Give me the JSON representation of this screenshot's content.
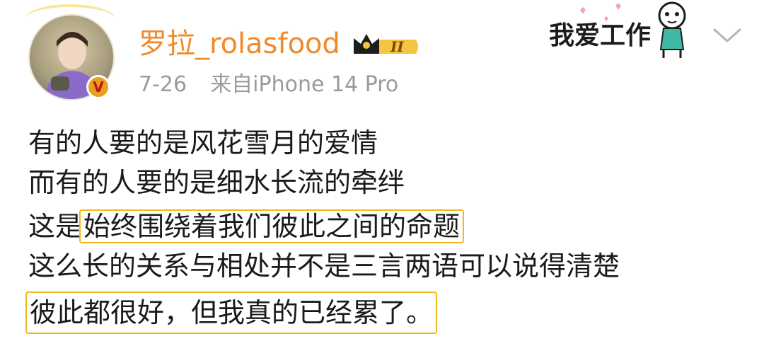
{
  "post": {
    "author": {
      "name": "罗拉_rolasfood",
      "vip_level": "II",
      "verified_mark": "V"
    },
    "meta": {
      "date": "7-26",
      "source": "来自iPhone 14 Pro"
    },
    "sticker_text": "我爱工作",
    "lines": [
      {
        "plain": "有的人要的是风花雪月的爱情"
      },
      {
        "plain": "而有的人要的是细水长流的牵绊"
      },
      {
        "prefix": "这是",
        "highlight": "始终围绕着我们彼此之间的命题"
      },
      {
        "plain": "这么长的关系与相处并不是三言两语可以说得清楚"
      },
      {
        "highlight": "彼此都很好，但我真的已经累了。"
      }
    ],
    "colors": {
      "username": "#f08a2a",
      "highlight_border": "#f2b81c",
      "meta": "#9a9a9a",
      "body_text": "#1a1a1a"
    },
    "icons": [
      "verified-badge-icon",
      "vip-crown-icon",
      "more-chevron-down-icon",
      "sticker-character-icon"
    ]
  }
}
